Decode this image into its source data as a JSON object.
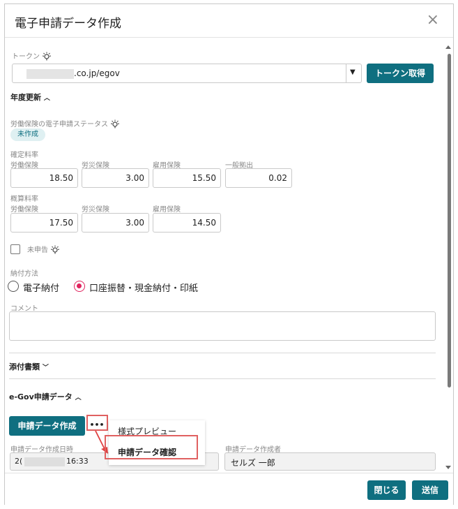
{
  "dialog": {
    "title": "電子申請データ作成",
    "close": "×"
  },
  "token": {
    "label": "トークン",
    "value": ".co.jp/egov",
    "dropdown_arrow": "▼",
    "get_button": "トークン取得"
  },
  "annual": {
    "heading": "年度更新",
    "status_label": "労働保険の電子申請ステータス",
    "status_badge": "未作成",
    "confirmed_title": "確定料率",
    "confirmed": [
      {
        "label": "労働保険",
        "value": "18.50"
      },
      {
        "label": "労災保険",
        "value": "3.00"
      },
      {
        "label": "雇用保険",
        "value": "15.50"
      },
      {
        "label": "一般拠出",
        "value": "0.02"
      }
    ],
    "estimated_title": "概算料率",
    "estimated": [
      {
        "label": "労働保険",
        "value": "17.50"
      },
      {
        "label": "労災保険",
        "value": "3.00"
      },
      {
        "label": "雇用保険",
        "value": "14.50"
      }
    ],
    "not_declared_label": "未申告",
    "payment_label": "納付方法",
    "payment_options": [
      "電子納付",
      "口座振替・現金納付・印紙"
    ],
    "payment_selected": 1,
    "comment_label": "コメント"
  },
  "attachments": {
    "heading": "添付書類"
  },
  "egov": {
    "heading": "e-Gov申請データ",
    "create_button": "申請データ作成",
    "more_button": "•••",
    "created_at_label": "申請データ作成日時",
    "created_at_prefix": "2(",
    "created_at_suffix": "16:33",
    "creator_label": "申請データ作成者",
    "creator_value": "セルズ 一郎"
  },
  "menu": {
    "items": [
      "様式プレビュー",
      "申請データ確認"
    ],
    "highlighted": 1
  },
  "footer": {
    "close_button": "閉じる",
    "send_button": "送信"
  },
  "colors": {
    "accent": "#0f6f80",
    "radio_selected": "#e0245e",
    "highlight": "#e06060",
    "badge_bg": "#dff0f2"
  }
}
